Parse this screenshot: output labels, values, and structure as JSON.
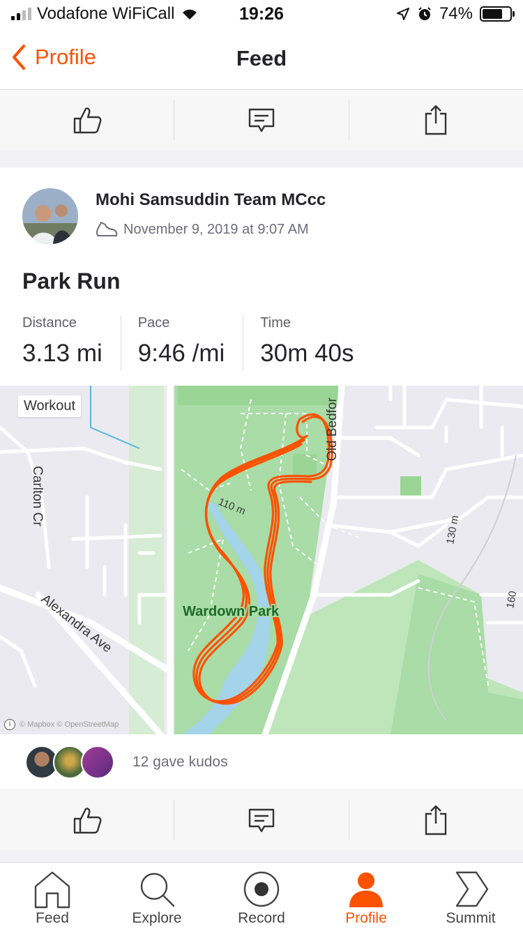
{
  "status_bar": {
    "carrier": "Vodafone WiFiCall",
    "time": "19:26",
    "battery": "74%",
    "battery_level": 0.74
  },
  "nav": {
    "back_label": "Profile",
    "title": "Feed"
  },
  "action_icons": [
    "thumbs-up-icon",
    "comment-icon",
    "share-icon"
  ],
  "activity": {
    "athlete": "Mohi Samsuddin Team MCcc",
    "datetime": "November 9, 2019 at 9:07 AM",
    "sport_icon": "shoe-icon",
    "title": "Park Run",
    "stats": [
      {
        "label": "Distance",
        "value": "3.13 mi"
      },
      {
        "label": "Pace",
        "value": "9:46 /mi"
      },
      {
        "label": "Time",
        "value": "30m 40s"
      }
    ],
    "map": {
      "badge": "Workout",
      "labels": {
        "park": "Wardown Park",
        "street1": "Carlton Cr",
        "street2": "Alexandra Ave",
        "street3": "Old Bedfor",
        "contour1": "110 m",
        "contour2": "130 m",
        "contour3": "160"
      },
      "credit": "© Mapbox © OpenStreetMap",
      "route_color": "#fc5200"
    },
    "kudos_text": "12 gave kudos"
  },
  "tabs": [
    {
      "label": "Feed",
      "icon": "home-icon"
    },
    {
      "label": "Explore",
      "icon": "search-icon"
    },
    {
      "label": "Record",
      "icon": "record-icon"
    },
    {
      "label": "Profile",
      "icon": "profile-icon"
    },
    {
      "label": "Summit",
      "icon": "summit-icon"
    }
  ],
  "colors": {
    "accent": "#fc5200",
    "text": "#242428",
    "muted": "#6d6d78"
  }
}
